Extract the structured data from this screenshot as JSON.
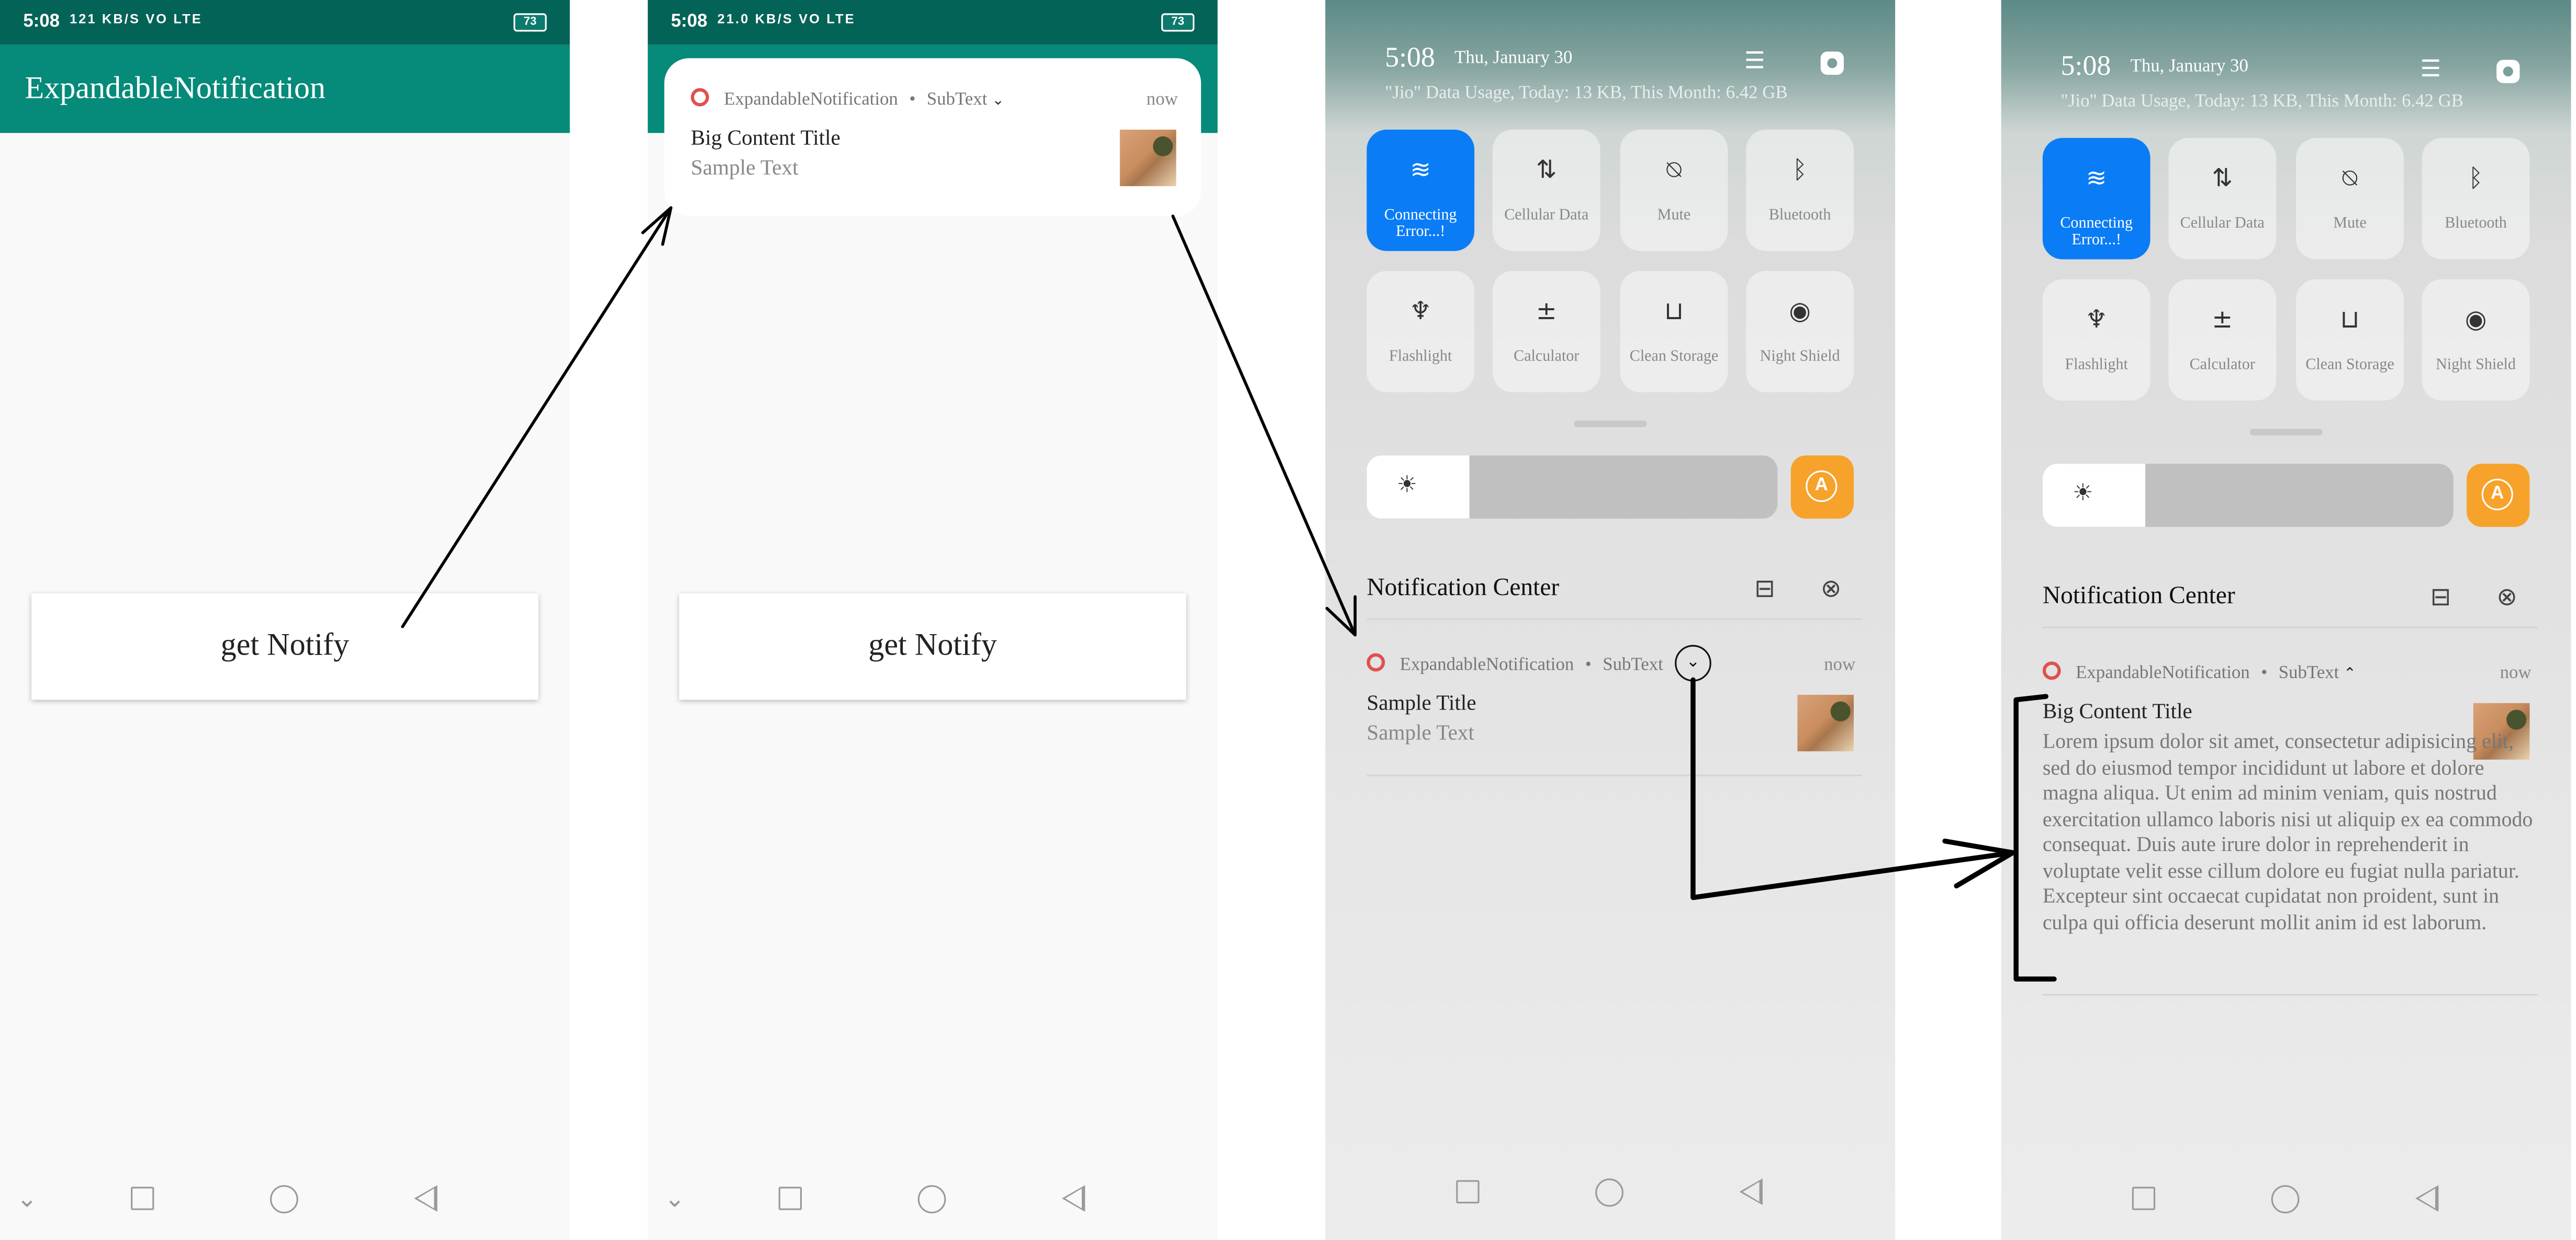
{
  "status": {
    "time": "5:08",
    "battery": "73",
    "net_icons_1": "121 KB/S VO LTE",
    "net_icons_2": "21.0 KB/S VO LTE"
  },
  "app": {
    "title": "ExpandableNotification",
    "button_label": "get Notify"
  },
  "notification": {
    "app_name": "ExpandableNotification",
    "sep": "•",
    "subtext": "SubText",
    "time": "now",
    "big_title": "Big Content Title",
    "title": "Sample Title",
    "text": "Sample Text",
    "long_text": "Lorem ipsum dolor sit amet, consectetur adipisicing elit, sed do eiusmod tempor incididunt ut labore et dolore magna aliqua. Ut enim ad minim veniam, quis nostrud exercitation ullamco laboris nisi ut aliquip ex ea commodo consequat. Duis aute irure dolor in reprehenderit in voluptate velit esse cillum dolore eu fugiat nulla pariatur. Excepteur sint occaecat cupidatat non proident, sunt in culpa qui officia deserunt mollit anim id est laborum."
  },
  "quick_settings": {
    "time": "5:08",
    "date": "Thu, January 30",
    "usage": "\"Jio\" Data Usage, Today: 13 KB, This Month: 6.42 GB",
    "tiles": [
      {
        "label": "Connecting Error...!",
        "icon": "wifi-icon",
        "active": true
      },
      {
        "label": "Cellular Data",
        "icon": "cellular-data-icon",
        "active": false
      },
      {
        "label": "Mute",
        "icon": "mute-bell-icon",
        "active": false
      },
      {
        "label": "Bluetooth",
        "icon": "bluetooth-icon",
        "active": false
      },
      {
        "label": "Flashlight",
        "icon": "flashlight-icon",
        "active": false
      },
      {
        "label": "Calculator",
        "icon": "calculator-icon",
        "active": false
      },
      {
        "label": "Clean Storage",
        "icon": "trash-icon",
        "active": false
      },
      {
        "label": "Night Shield",
        "icon": "eye-icon",
        "active": false
      }
    ],
    "brightness": 0.25,
    "auto_label": "A",
    "accent": "#0a7cf5",
    "auto_color": "#f7a22b"
  },
  "notification_center": {
    "title": "Notification Center"
  },
  "colors": {
    "app_bar": "#068a7a",
    "status_bar": "#046357"
  }
}
